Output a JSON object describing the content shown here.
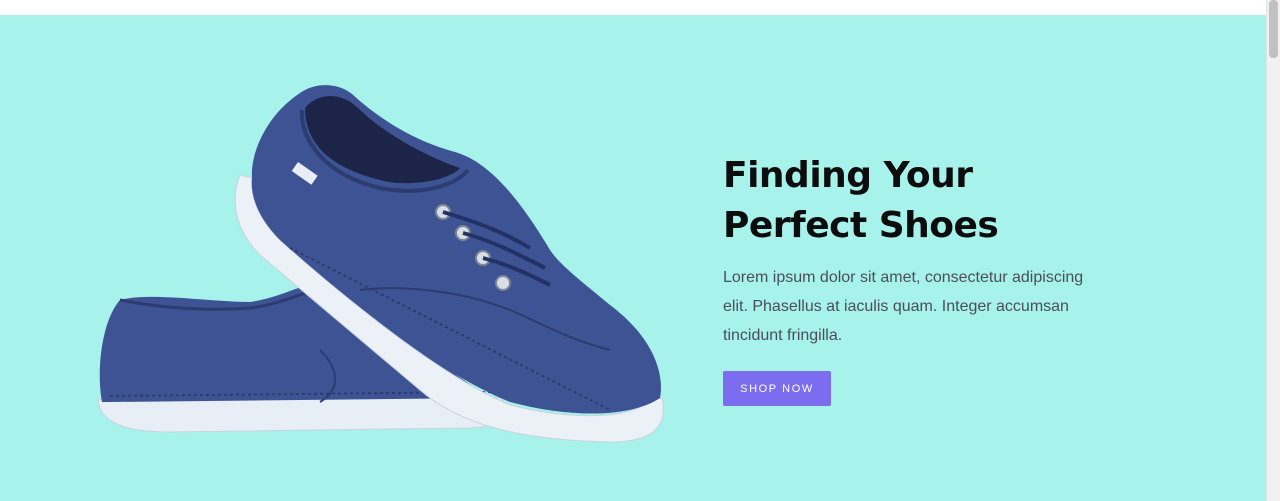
{
  "hero": {
    "title_line1": "Finding Your",
    "title_line2": "Perfect Shoes",
    "description": "Lorem ipsum dolor sit amet, consectetur adipiscing elit. Phasellus at iaculis quam. Integer accumsan tincidunt fringilla.",
    "cta_label": "SHOP NOW",
    "image": "blue-canvas-sneakers-image"
  },
  "colors": {
    "hero_background": "#a7f2ea",
    "cta_background": "#7b6cf0",
    "title_text": "#0d0d0d",
    "body_text": "#4a4e5a",
    "shoe_canvas": "#3e5394"
  }
}
